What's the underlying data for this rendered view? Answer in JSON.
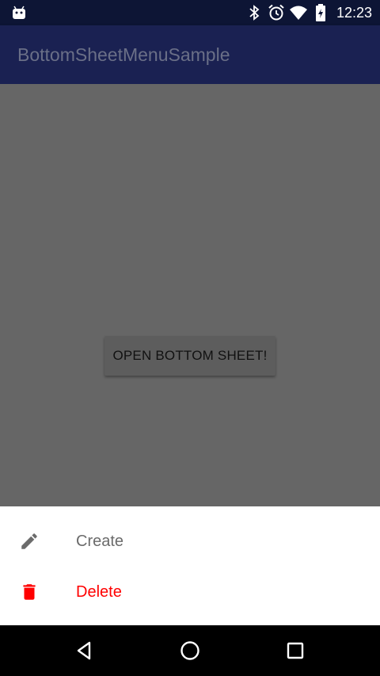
{
  "status_bar": {
    "time": "12:23",
    "icons": [
      "android-icon",
      "bluetooth-icon",
      "alarm-icon",
      "wifi-icon",
      "battery-icon"
    ]
  },
  "app_bar": {
    "title": "BottomSheetMenuSample"
  },
  "main": {
    "open_button_label": "OPEN BOTTOM SHEET!"
  },
  "bottom_sheet": {
    "items": [
      {
        "label": "Create",
        "icon": "pencil-icon",
        "color": "#6b6b6b"
      },
      {
        "label": "Delete",
        "icon": "trash-icon",
        "color": "#ff0000"
      }
    ]
  },
  "nav_bar": {
    "icons": [
      "back-icon",
      "home-icon",
      "recent-apps-icon"
    ]
  },
  "colors": {
    "status_bar": "#0d1535",
    "app_bar": "#1a2152",
    "scrim": "#666666",
    "delete_accent": "#ff0000"
  }
}
